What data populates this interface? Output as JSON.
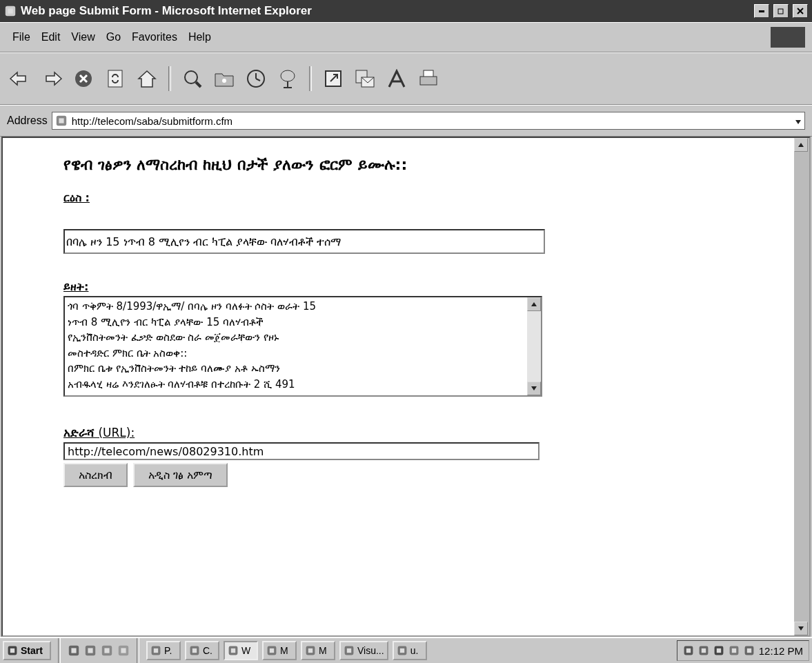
{
  "window": {
    "title": "Web page Submit Form - Microsoft Internet Explorer"
  },
  "menu": [
    "File",
    "Edit",
    "View",
    "Go",
    "Favorites",
    "Help"
  ],
  "toolbar": [
    {
      "kind": "back"
    },
    {
      "kind": "forward"
    },
    {
      "kind": "stop"
    },
    {
      "kind": "refresh"
    },
    {
      "kind": "home"
    },
    {
      "kind": "sep"
    },
    {
      "kind": "search"
    },
    {
      "kind": "favorites"
    },
    {
      "kind": "history"
    },
    {
      "kind": "channels"
    },
    {
      "kind": "sep"
    },
    {
      "kind": "fullscreen"
    },
    {
      "kind": "mail"
    },
    {
      "kind": "font"
    },
    {
      "kind": "print"
    }
  ],
  "address": {
    "label": "Address",
    "value": "http://telecom/saba/submitform.cfm"
  },
  "page": {
    "heading": "የዌብ ገፅዎን ለማስረከብ ከዚህ በታች ያለውን ፎርም ይሙሉ::",
    "title_label": "ርዕስ :",
    "title_value": "በባሌ ዞን 15 ነጥብ 8 ሚሊየን ብር ካፒል ያላቸው ባለሃብቶች ተሰማ",
    "content_label": "ይዘት:",
    "content_lines": [
      "ጎባ ጥቅምት 8/1993/ዋኢማ/ በባሌ ዞን ባለፉት ሶስት ወራት 15",
      "ነጥብ 8 ሚሊየን ብር ካፒል ያላቸው 15 ባለሃብቶች",
      "የኢንቨስትመንት ፈቃድ ወስደው ስራ መጀመራቸውን የዞኑ",
      "መስተዳድር ምክር ቤት አስወቀ::",
      "በምክር ቤቱ የኢንቨስትመንት ተከይ ባለሙያ አቶ ኡስማን",
      "አብዱላሂ ዛሬ እንደገለፁት ባለሃብቶቹ በተረከቡት 2 ሺ 491"
    ],
    "url_label": "**አድራሻ**  (URL):",
    "url_value": "http://telecom/news/08029310.htm",
    "buttons": [
      "አስረክብ",
      "አዲስ ገፅ አምጣ"
    ]
  },
  "taskbar": {
    "start": "Start",
    "tasks": [
      {
        "label": "P.",
        "selected": false
      },
      {
        "label": "C.",
        "selected": false
      },
      {
        "label": "W",
        "selected": true
      },
      {
        "label": "M",
        "selected": false
      },
      {
        "label": "M",
        "selected": false
      },
      {
        "label": "Visu...",
        "selected": false
      },
      {
        "label": "u.",
        "selected": false
      }
    ],
    "clock": "12:12 PM"
  }
}
